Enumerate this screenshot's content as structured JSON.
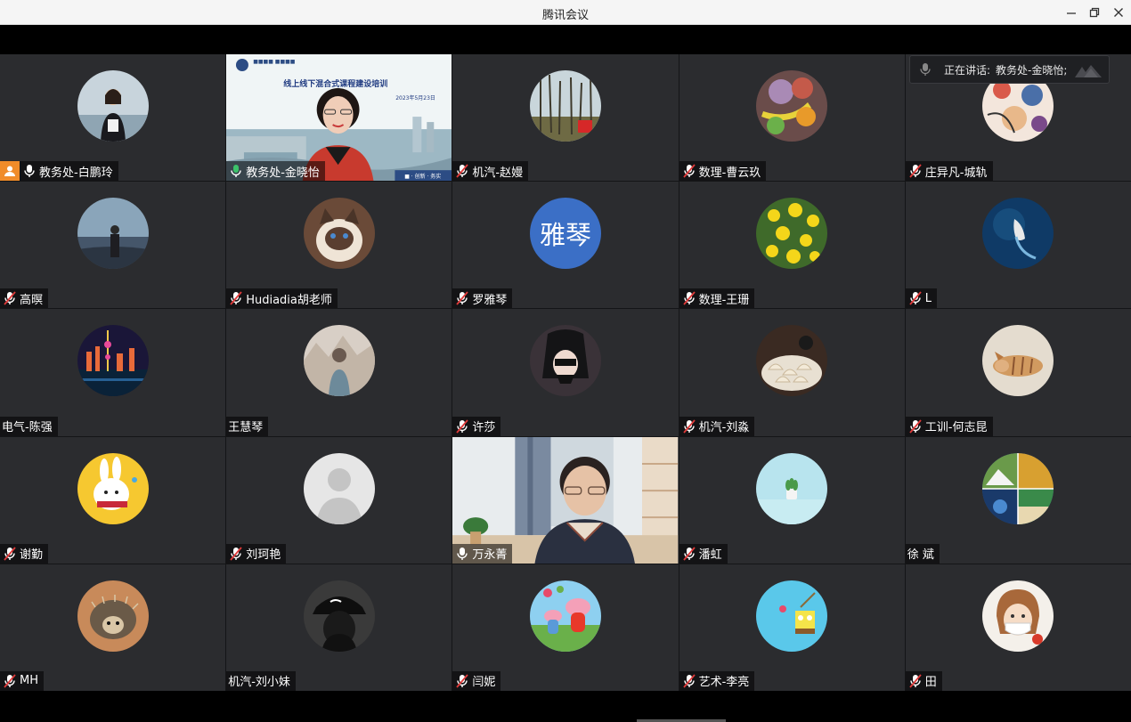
{
  "window": {
    "title": "腾讯会议"
  },
  "speaking": {
    "label": "正在讲话:",
    "name": "教务处-金晓怡;"
  },
  "slide": {
    "title": "线上线下混合式课程建设培训",
    "date": "2023年5月23日",
    "footer": "■ · 创新 · 务实"
  },
  "participants": [
    {
      "name": "教务处-白鹏玲",
      "avatar": "photo-woman-lake",
      "mic": "on",
      "host": true
    },
    {
      "name": "教务处-金晓怡",
      "avatar": "video-presentation",
      "mic": "speaking",
      "active": true
    },
    {
      "name": "机汽-赵嫚",
      "avatar": "photo-forest",
      "mic": "muted"
    },
    {
      "name": "数理-曹云玖",
      "avatar": "photo-fruit",
      "mic": "muted"
    },
    {
      "name": "庄异凡-城轨",
      "avatar": "photo-cartoon",
      "mic": "muted"
    },
    {
      "name": "高暝",
      "avatar": "photo-sea-man",
      "mic": "muted"
    },
    {
      "name": "Hudiadia胡老师",
      "avatar": "photo-cat",
      "mic": "muted"
    },
    {
      "name": "罗雅琴",
      "avatar": "text",
      "avatar_text": "雅琴",
      "mic": "muted"
    },
    {
      "name": "数理-王珊",
      "avatar": "photo-yellow-flowers",
      "mic": "muted"
    },
    {
      "name": "L",
      "avatar": "photo-ocean-boat",
      "mic": "muted"
    },
    {
      "name": "电气-陈强",
      "avatar": "photo-city-night",
      "mic": "none"
    },
    {
      "name": "王慧琴",
      "avatar": "photo-painting",
      "mic": "none"
    },
    {
      "name": "许莎",
      "avatar": "photo-dark-anime",
      "mic": "muted"
    },
    {
      "name": "机汽-刘淼",
      "avatar": "photo-dumplings",
      "mic": "muted"
    },
    {
      "name": "工训-何志昆",
      "avatar": "photo-cat-tabby",
      "mic": "muted"
    },
    {
      "name": "谢勤",
      "avatar": "photo-rabbit-cartoon",
      "mic": "muted"
    },
    {
      "name": "刘珂艳",
      "avatar": "placeholder-person",
      "mic": "muted"
    },
    {
      "name": "万永菁",
      "avatar": "video-woman",
      "mic": "on"
    },
    {
      "name": "潘虹",
      "avatar": "photo-plant",
      "mic": "muted"
    },
    {
      "name": "徐 斌",
      "avatar": "photo-collage",
      "mic": "none"
    },
    {
      "name": "MH",
      "avatar": "photo-hedgehog",
      "mic": "muted"
    },
    {
      "name": "机汽-刘小妹",
      "avatar": "photo-black-cap",
      "mic": "none"
    },
    {
      "name": "闫妮",
      "avatar": "photo-peppa",
      "mic": "muted"
    },
    {
      "name": "艺术-李亮",
      "avatar": "photo-spongebob",
      "mic": "muted"
    },
    {
      "name": "田",
      "avatar": "photo-mask-girl",
      "mic": "muted"
    }
  ]
}
